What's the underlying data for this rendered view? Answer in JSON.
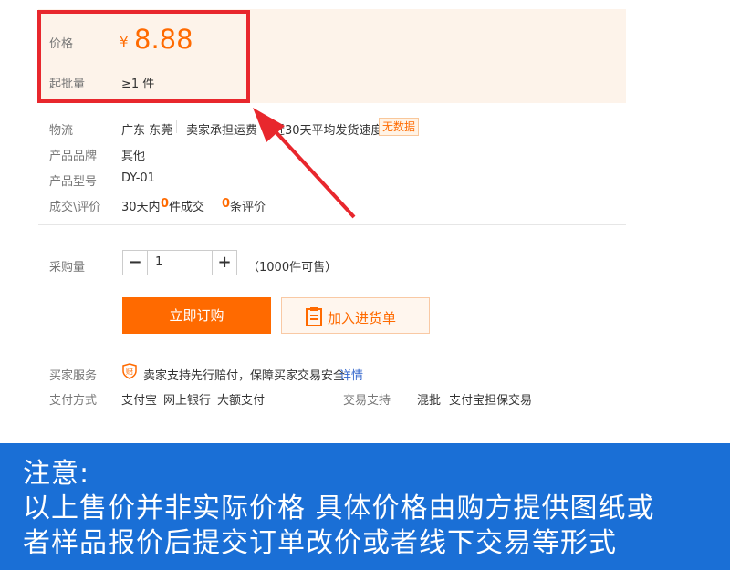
{
  "price": {
    "label": "价格",
    "currency": "¥",
    "value": "8.88",
    "moq_label": "起批量",
    "moq_value": "≥1 件"
  },
  "logistics": {
    "label": "物流",
    "location": "广东 东莞",
    "shipping": "卖家承担运费",
    "speed_label": "近30天平均发货速度：",
    "speed_value": "无数据"
  },
  "brand": {
    "label": "产品品牌",
    "value": "其他"
  },
  "model": {
    "label": "产品型号",
    "value": "DY-01"
  },
  "deals": {
    "label": "成交\\评价",
    "period": "30天内",
    "deal_count": "0",
    "deal_suffix": "件成交",
    "review_count": "0",
    "review_suffix": "条评价"
  },
  "purchase": {
    "label": "采购量",
    "minus": "−",
    "quantity": "1",
    "plus": "+",
    "stock": "（1000件可售）"
  },
  "buttons": {
    "order": "立即订购",
    "cart": "加入进货单"
  },
  "service": {
    "label": "买家服务",
    "text": "卖家支持先行赔付，保障买家交易安全",
    "link": "详情"
  },
  "payment": {
    "label": "支付方式",
    "methods": [
      "支付宝",
      "网上银行",
      "大额支付"
    ]
  },
  "trade": {
    "label": "交易支持",
    "methods": [
      "混批",
      "支付宝担保交易"
    ]
  },
  "notice": {
    "line1": "注意:",
    "line2": "以上售价并非实际价格 具体价格由购方提供图纸或",
    "line3": "者样品报价后提交订单改价或者线下交易等形式"
  },
  "colors": {
    "accent": "#ff6a00",
    "highlight": "#e8272d",
    "notice_bg": "#1a6fd6",
    "link": "#3366cc"
  },
  "icons": [
    "minus-icon",
    "plus-icon",
    "clipboard-icon",
    "shield-icon",
    "arrow-annotation"
  ]
}
